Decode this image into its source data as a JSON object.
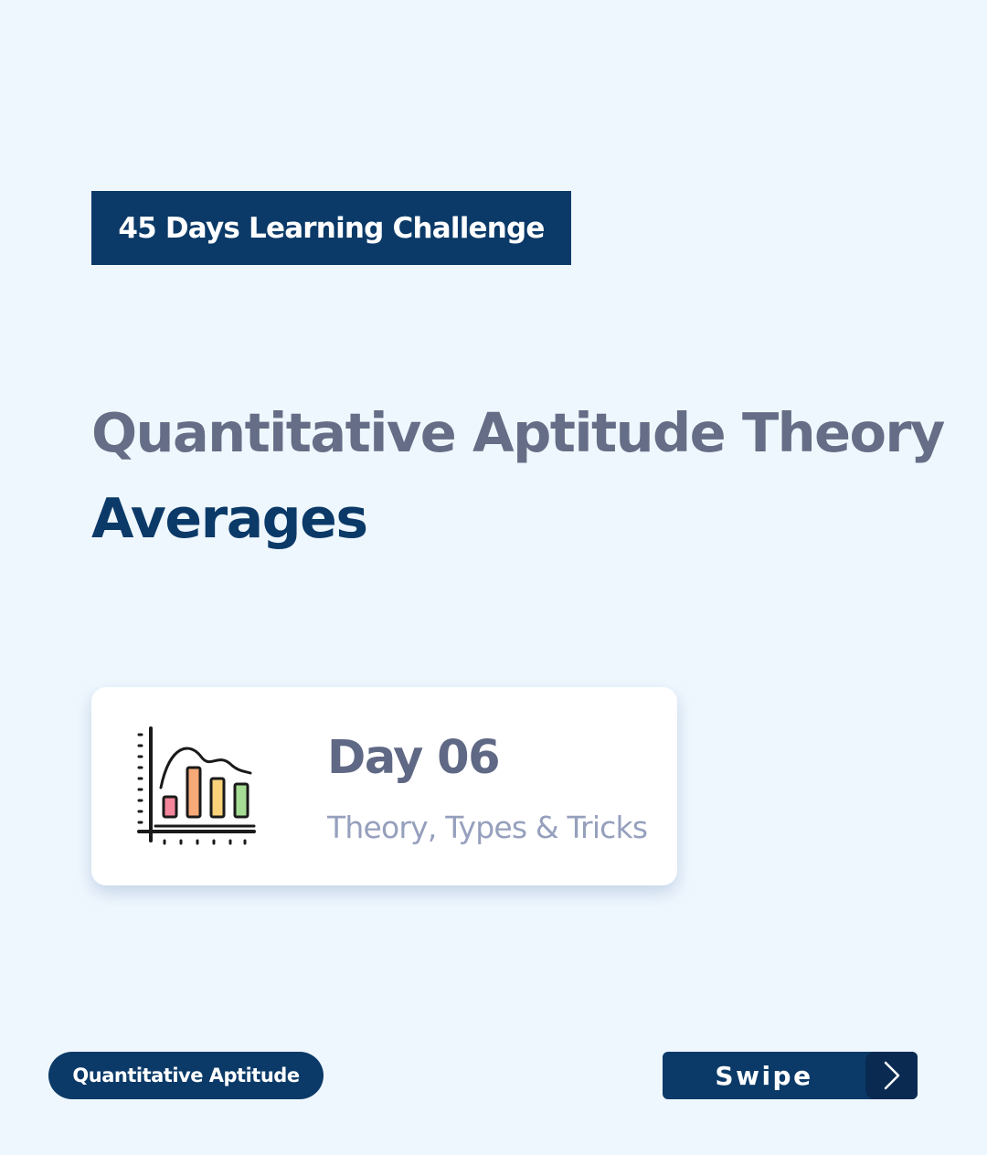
{
  "challenge_badge": "45 Days Learning Challenge",
  "subject_title": "Quantitative Aptitude Theory",
  "topic_title": "Averages",
  "day_card": {
    "icon": "bar-chart-icon",
    "day_label": "Day 06",
    "subtitle": "Theory, Types & Tricks"
  },
  "category_pill": "Quantitative Aptitude",
  "swipe": {
    "label": "Swipe",
    "icon": "chevron-right-icon"
  },
  "colors": {
    "background": "#eff7fe",
    "brand_navy": "#0b3a68",
    "title_gray": "#656e86",
    "subtitle_gray": "#96a0bd",
    "bar_pink": "#f4869c",
    "bar_orange": "#f7a977",
    "bar_yellow": "#f9d27a",
    "bar_green": "#a6dd94"
  }
}
